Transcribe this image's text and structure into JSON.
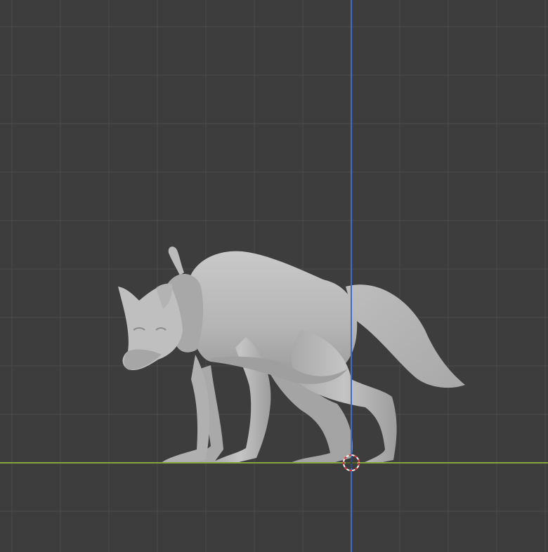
{
  "viewport": {
    "background_color": "#3d3d3d",
    "grid_color": "#4a4a4a",
    "x_axis_color": "#84a63a",
    "z_axis_color": "#3f6ec9",
    "model_color": "#b9b9b9",
    "model_shadow_color": "#8e8e8e",
    "model_highlight_color": "#d6d6d6",
    "cursor_ring_color": "#ffffff",
    "cursor_dash_color": "#d33a3a"
  },
  "objects": {
    "model_name": "wolf-sculpt",
    "cursor_icon": "3d-cursor-icon"
  }
}
